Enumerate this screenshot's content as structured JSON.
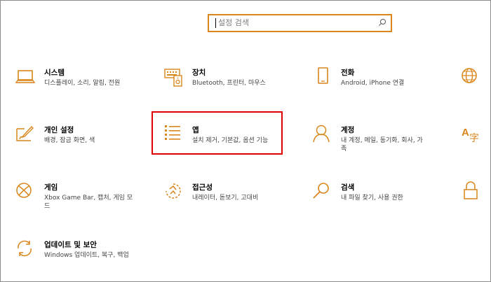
{
  "search": {
    "placeholder": "설정 검색"
  },
  "accent_color": "#d9861c",
  "highlight_color": "#e00000",
  "tiles": {
    "system": {
      "title": "시스템",
      "desc": "디스플레이, 소리, 알림, 전원",
      "icon": "laptop-icon"
    },
    "devices": {
      "title": "장치",
      "desc": "Bluetooth, 프린터, 마우스",
      "icon": "keyboard-speaker-icon"
    },
    "phone": {
      "title": "전화",
      "desc": "Android, iPhone 연결",
      "icon": "phone-icon"
    },
    "personal": {
      "title": "개인 설정",
      "desc": "배경, 잠금 화면, 색",
      "icon": "paint-brush-icon"
    },
    "apps": {
      "title": "앱",
      "desc": "설치 제거, 기본값, 옵션 기능",
      "icon": "apps-list-icon"
    },
    "accounts": {
      "title": "계정",
      "desc": "내 계정, 메일, 동기화, 회사, 가",
      "desc2": "족",
      "icon": "person-icon"
    },
    "gaming": {
      "title": "게임",
      "desc": "Xbox Game Bar, 캡처, 게임 모",
      "desc2": "드",
      "icon": "xbox-icon"
    },
    "ease": {
      "title": "접근성",
      "desc": "내레이터, 돋보기, 고대비",
      "icon": "ease-of-access-icon"
    },
    "search": {
      "title": "검색",
      "desc": "내 파일 찾기, 사용 권한",
      "icon": "magnifier-icon"
    },
    "update": {
      "title": "업데이트 및 보안",
      "desc": "Windows 업데이트, 복구, 백업",
      "icon": "sync-icon"
    }
  }
}
